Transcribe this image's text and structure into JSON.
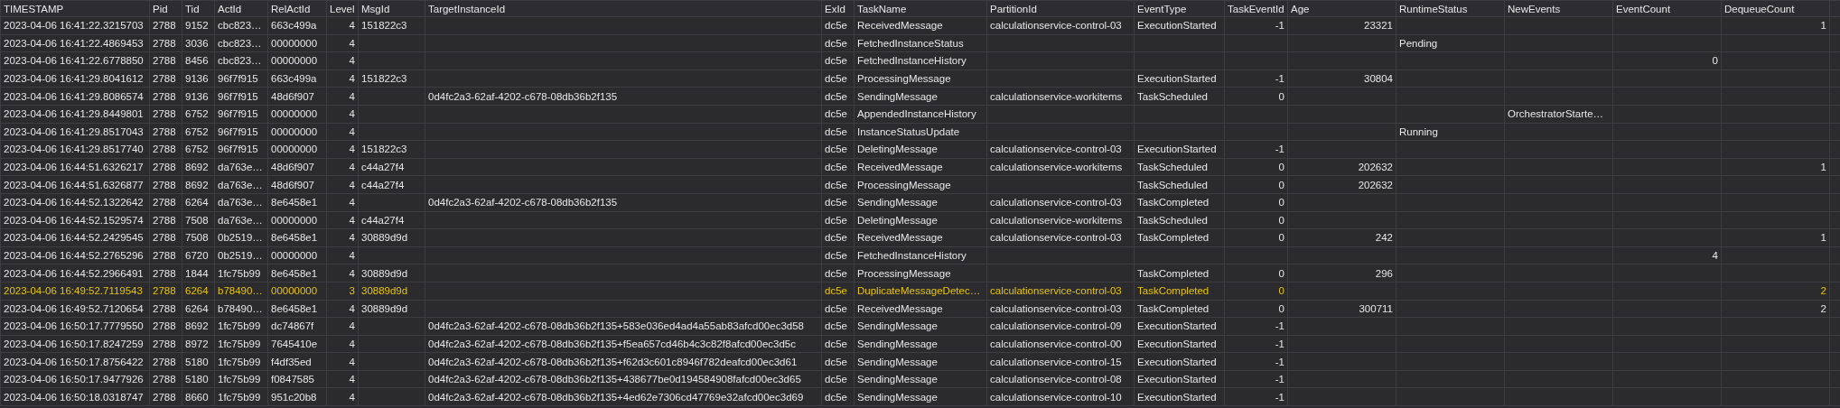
{
  "table": {
    "columns": [
      {
        "label": "TIMESTAMP"
      },
      {
        "label": "Pid"
      },
      {
        "label": "Tid"
      },
      {
        "label": "ActId"
      },
      {
        "label": "RelActId"
      },
      {
        "label": "Level"
      },
      {
        "label": "MsgId"
      },
      {
        "label": "TargetInstanceId"
      },
      {
        "label": "ExId"
      },
      {
        "label": "TaskName"
      },
      {
        "label": "PartitionId"
      },
      {
        "label": "EventType"
      },
      {
        "label": "TaskEventId"
      },
      {
        "label": "Age"
      },
      {
        "label": "RuntimeStatus"
      },
      {
        "label": "NewEvents"
      },
      {
        "label": "EventCount"
      },
      {
        "label": "DequeueCount"
      }
    ],
    "rows": [
      {
        "highlighted": false,
        "cells": [
          "2023-04-06 16:41:22.3215703",
          "2788",
          "9152",
          "cbc823…",
          "663c499a",
          "4",
          "151822c3",
          "",
          "dc5e",
          "ReceivedMessage",
          "calculationservice-control-03",
          "ExecutionStarted",
          "-1",
          "23321",
          "",
          "",
          "",
          "1"
        ]
      },
      {
        "highlighted": false,
        "cells": [
          "2023-04-06 16:41:22.4869453",
          "2788",
          "3036",
          "cbc823…",
          "00000000",
          "4",
          "",
          "",
          "dc5e",
          "FetchedInstanceStatus",
          "",
          "",
          "",
          "",
          "Pending",
          "",
          "",
          ""
        ]
      },
      {
        "highlighted": false,
        "cells": [
          "2023-04-06 16:41:22.6778850",
          "2788",
          "8456",
          "cbc823…",
          "00000000",
          "4",
          "",
          "",
          "dc5e",
          "FetchedInstanceHistory",
          "",
          "",
          "",
          "",
          "",
          "",
          "0",
          ""
        ]
      },
      {
        "highlighted": false,
        "cells": [
          "2023-04-06 16:41:29.8041612",
          "2788",
          "9136",
          "96f7f915",
          "663c499a",
          "4",
          "151822c3",
          "",
          "dc5e",
          "ProcessingMessage",
          "",
          "ExecutionStarted",
          "-1",
          "30804",
          "",
          "",
          "",
          ""
        ]
      },
      {
        "highlighted": false,
        "cells": [
          "2023-04-06 16:41:29.8086574",
          "2788",
          "9136",
          "96f7f915",
          "48d6f907",
          "4",
          "",
          "0d4fc2a3-62af-4202-c678-08db36b2f135",
          "dc5e",
          "SendingMessage",
          "calculationservice-workitems",
          "TaskScheduled",
          "0",
          "",
          "",
          "",
          "",
          ""
        ]
      },
      {
        "highlighted": false,
        "cells": [
          "2023-04-06 16:41:29.8449801",
          "2788",
          "6752",
          "96f7f915",
          "00000000",
          "4",
          "",
          "",
          "dc5e",
          "AppendedInstanceHistory",
          "",
          "",
          "",
          "",
          "",
          "OrchestratorStarte…",
          "",
          ""
        ]
      },
      {
        "highlighted": false,
        "cells": [
          "2023-04-06 16:41:29.8517043",
          "2788",
          "6752",
          "96f7f915",
          "00000000",
          "4",
          "",
          "",
          "dc5e",
          "InstanceStatusUpdate",
          "",
          "",
          "",
          "",
          "Running",
          "",
          "",
          ""
        ]
      },
      {
        "highlighted": false,
        "cells": [
          "2023-04-06 16:41:29.8517740",
          "2788",
          "6752",
          "96f7f915",
          "00000000",
          "4",
          "151822c3",
          "",
          "dc5e",
          "DeletingMessage",
          "calculationservice-control-03",
          "ExecutionStarted",
          "-1",
          "",
          "",
          "",
          "",
          ""
        ]
      },
      {
        "highlighted": false,
        "cells": [
          "2023-04-06 16:44:51.6326217",
          "2788",
          "8692",
          "da763e…",
          "48d6f907",
          "4",
          "c44a27f4",
          "",
          "dc5e",
          "ReceivedMessage",
          "calculationservice-workitems",
          "TaskScheduled",
          "0",
          "202632",
          "",
          "",
          "",
          "1"
        ]
      },
      {
        "highlighted": false,
        "cells": [
          "2023-04-06 16:44:51.6326877",
          "2788",
          "8692",
          "da763e…",
          "48d6f907",
          "4",
          "c44a27f4",
          "",
          "dc5e",
          "ProcessingMessage",
          "",
          "TaskScheduled",
          "0",
          "202632",
          "",
          "",
          "",
          ""
        ]
      },
      {
        "highlighted": false,
        "cells": [
          "2023-04-06 16:44:52.1322642",
          "2788",
          "6264",
          "da763e…",
          "8e6458e1",
          "4",
          "",
          "0d4fc2a3-62af-4202-c678-08db36b2f135",
          "dc5e",
          "SendingMessage",
          "calculationservice-control-03",
          "TaskCompleted",
          "0",
          "",
          "",
          "",
          "",
          ""
        ]
      },
      {
        "highlighted": false,
        "cells": [
          "2023-04-06 16:44:52.1529574",
          "2788",
          "7508",
          "da763e…",
          "00000000",
          "4",
          "c44a27f4",
          "",
          "dc5e",
          "DeletingMessage",
          "calculationservice-workitems",
          "TaskScheduled",
          "0",
          "",
          "",
          "",
          "",
          ""
        ]
      },
      {
        "highlighted": false,
        "cells": [
          "2023-04-06 16:44:52.2429545",
          "2788",
          "7508",
          "0b2519…",
          "8e6458e1",
          "4",
          "30889d9d",
          "",
          "dc5e",
          "ReceivedMessage",
          "calculationservice-control-03",
          "TaskCompleted",
          "0",
          "242",
          "",
          "",
          "",
          "1"
        ]
      },
      {
        "highlighted": false,
        "cells": [
          "2023-04-06 16:44:52.2765296",
          "2788",
          "6720",
          "0b2519…",
          "00000000",
          "4",
          "",
          "",
          "dc5e",
          "FetchedInstanceHistory",
          "",
          "",
          "",
          "",
          "",
          "",
          "4",
          ""
        ]
      },
      {
        "highlighted": false,
        "cells": [
          "2023-04-06 16:44:52.2966491",
          "2788",
          "1844",
          "1fc75b99",
          "8e6458e1",
          "4",
          "30889d9d",
          "",
          "dc5e",
          "ProcessingMessage",
          "",
          "TaskCompleted",
          "0",
          "296",
          "",
          "",
          "",
          ""
        ]
      },
      {
        "highlighted": true,
        "cells": [
          "2023-04-06 16:49:52.7119543",
          "2788",
          "6264",
          "b78490…",
          "00000000",
          "3",
          "30889d9d",
          "",
          "dc5e",
          "DuplicateMessageDetec…",
          "calculationservice-control-03",
          "TaskCompleted",
          "0",
          "",
          "",
          "",
          "",
          "2"
        ]
      },
      {
        "highlighted": false,
        "cells": [
          "2023-04-06 16:49:52.7120654",
          "2788",
          "6264",
          "b78490…",
          "8e6458e1",
          "4",
          "30889d9d",
          "",
          "dc5e",
          "ReceivedMessage",
          "calculationservice-control-03",
          "TaskCompleted",
          "0",
          "300711",
          "",
          "",
          "",
          "2"
        ]
      },
      {
        "highlighted": false,
        "cells": [
          "2023-04-06 16:50:17.7779550",
          "2788",
          "8692",
          "1fc75b99",
          "dc74867f",
          "4",
          "",
          "0d4fc2a3-62af-4202-c678-08db36b2f135+583e036ed4ad4a55ab83afcd00ec3d58",
          "dc5e",
          "SendingMessage",
          "calculationservice-control-09",
          "ExecutionStarted",
          "-1",
          "",
          "",
          "",
          "",
          ""
        ]
      },
      {
        "highlighted": false,
        "cells": [
          "2023-04-06 16:50:17.8247259",
          "2788",
          "8972",
          "1fc75b99",
          "7645410e",
          "4",
          "",
          "0d4fc2a3-62af-4202-c678-08db36b2f135+f5ea657cd46b4c3c82f8afcd00ec3d5c",
          "dc5e",
          "SendingMessage",
          "calculationservice-control-00",
          "ExecutionStarted",
          "-1",
          "",
          "",
          "",
          "",
          ""
        ]
      },
      {
        "highlighted": false,
        "cells": [
          "2023-04-06 16:50:17.8756422",
          "2788",
          "5180",
          "1fc75b99",
          "f4df35ed",
          "4",
          "",
          "0d4fc2a3-62af-4202-c678-08db36b2f135+f62d3c601c8946f782deafcd00ec3d61",
          "dc5e",
          "SendingMessage",
          "calculationservice-control-15",
          "ExecutionStarted",
          "-1",
          "",
          "",
          "",
          "",
          ""
        ]
      },
      {
        "highlighted": false,
        "cells": [
          "2023-04-06 16:50:17.9477926",
          "2788",
          "5180",
          "1fc75b99",
          "f0847585",
          "4",
          "",
          "0d4fc2a3-62af-4202-c678-08db36b2f135+438677be0d194584908fafcd00ec3d65",
          "dc5e",
          "SendingMessage",
          "calculationservice-control-08",
          "ExecutionStarted",
          "-1",
          "",
          "",
          "",
          "",
          ""
        ]
      },
      {
        "highlighted": false,
        "cells": [
          "2023-04-06 16:50:18.0318747",
          "2788",
          "8660",
          "1fc75b99",
          "951c20b8",
          "4",
          "",
          "0d4fc2a3-62af-4202-c678-08db36b2f135+4ed62e7306cd47769e32afcd00ec3d69",
          "dc5e",
          "SendingMessage",
          "calculationservice-control-10",
          "ExecutionStarted",
          "-1",
          "",
          "",
          "",
          "",
          ""
        ]
      }
    ]
  }
}
